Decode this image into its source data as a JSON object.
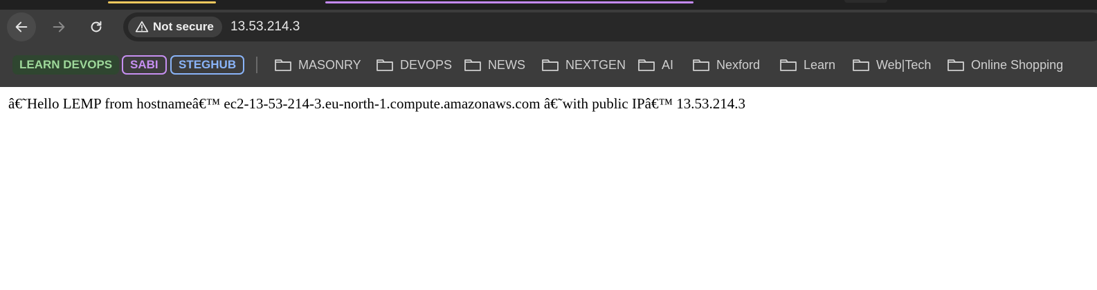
{
  "colors": {
    "tab_indicator_1": "#f4c95d",
    "tab_indicator_2": "#c58af9",
    "learn_devops_text": "#9ed89a",
    "sabi_accent": "#c790f2",
    "steghub_accent": "#8ab4f8"
  },
  "toolbar": {
    "back_icon": "arrow-left-icon",
    "forward_icon": "arrow-right-icon",
    "reload_icon": "reload-icon",
    "security_icon": "warning-triangle-icon",
    "security_label": "Not secure",
    "url": "13.53.214.3"
  },
  "bookmarks_bar": {
    "tags": [
      {
        "label": "LEARN DEVOPS"
      },
      {
        "label": "SABI"
      },
      {
        "label": "STEGHUB"
      }
    ],
    "folder_icon": "folder-icon",
    "folders": [
      {
        "label": "MASONRY"
      },
      {
        "label": "DEVOPS"
      },
      {
        "label": "NEWS"
      },
      {
        "label": "NEXTGEN"
      },
      {
        "label": "AI"
      },
      {
        "label": "Nexford"
      },
      {
        "label": "Learn"
      },
      {
        "label": "Web|Tech"
      },
      {
        "label": "Online Shopping"
      }
    ]
  },
  "page": {
    "text": "â€˜Hello LEMP from hostnameâ€™ ec2-13-53-214-3.eu-north-1.compute.amazonaws.com â€˜with public IPâ€™ 13.53.214.3"
  }
}
